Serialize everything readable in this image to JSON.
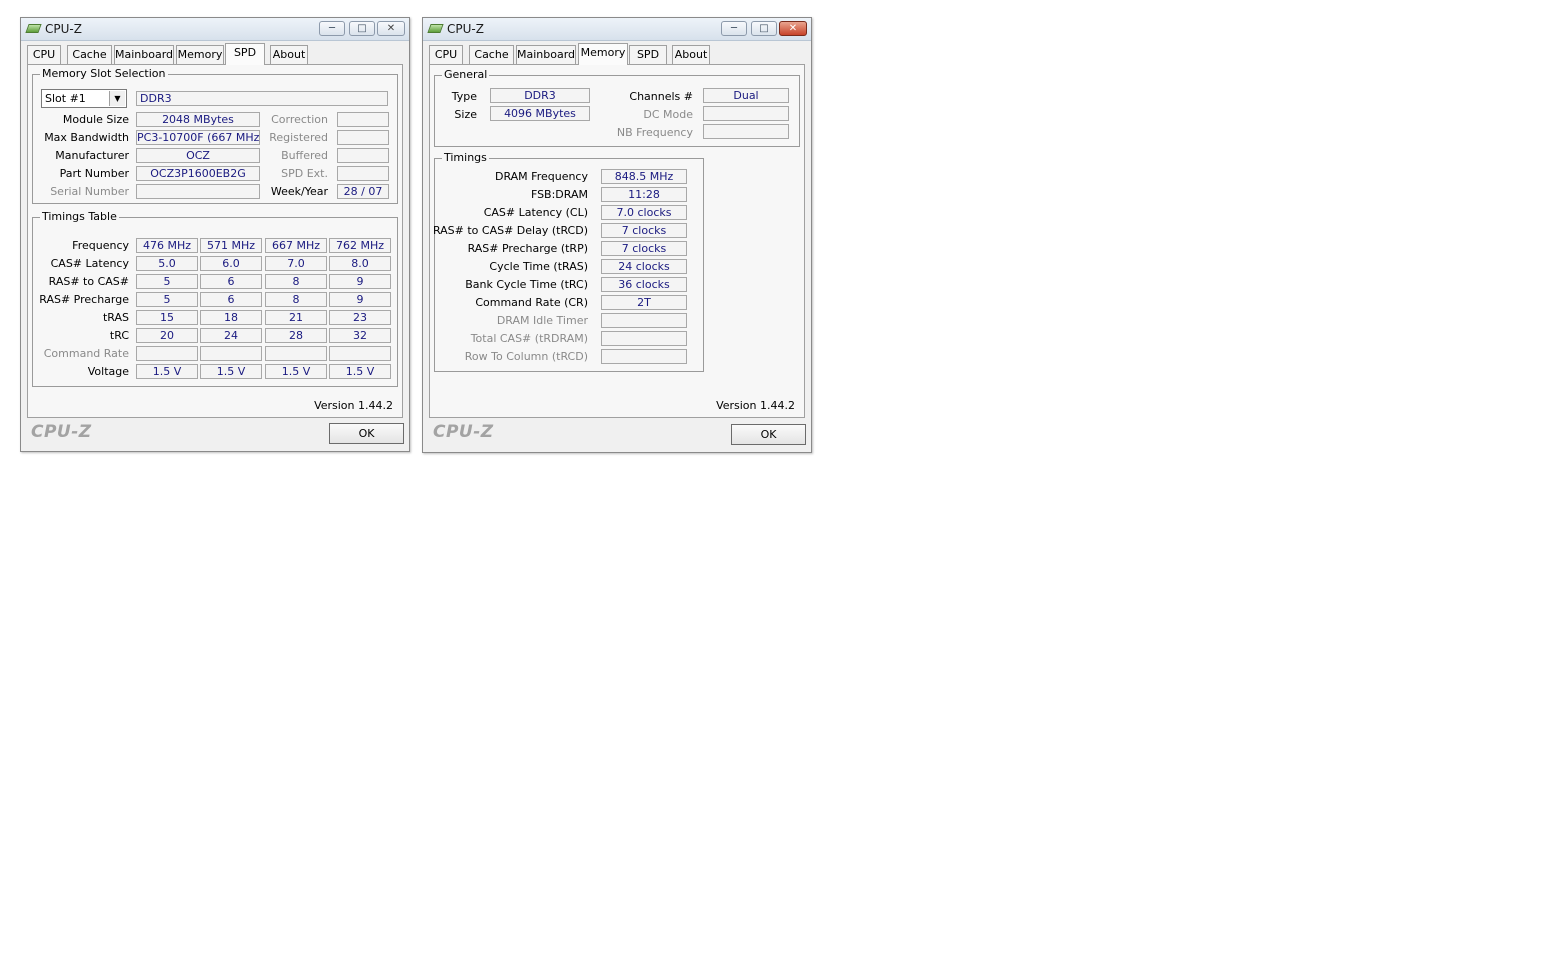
{
  "window1": {
    "title": "CPU-Z",
    "tabs": [
      "CPU",
      "Cache",
      "Mainboard",
      "Memory",
      "SPD",
      "About"
    ],
    "active_tab": "SPD",
    "slot_group_title": "Memory Slot Selection",
    "slot_select": "Slot #1",
    "slot_type": "DDR3",
    "left_fields": [
      {
        "label": "Module Size",
        "value": "2048 MBytes"
      },
      {
        "label": "Max Bandwidth",
        "value": "PC3-10700F (667 MHz)"
      },
      {
        "label": "Manufacturer",
        "value": "OCZ"
      },
      {
        "label": "Part Number",
        "value": "OCZ3P1600EB2G"
      },
      {
        "label": "Serial Number",
        "value": ""
      }
    ],
    "right_fields": [
      {
        "label": "Correction",
        "value": ""
      },
      {
        "label": "Registered",
        "value": ""
      },
      {
        "label": "Buffered",
        "value": ""
      },
      {
        "label": "SPD Ext.",
        "value": ""
      },
      {
        "label": "Week/Year",
        "value": "28 / 07"
      }
    ],
    "timings_group_title": "Timings Table",
    "timings_rows": [
      {
        "label": "Frequency",
        "values": [
          "476 MHz",
          "571 MHz",
          "667 MHz",
          "762 MHz"
        ]
      },
      {
        "label": "CAS# Latency",
        "values": [
          "5.0",
          "6.0",
          "7.0",
          "8.0"
        ]
      },
      {
        "label": "RAS# to CAS#",
        "values": [
          "5",
          "6",
          "8",
          "9"
        ]
      },
      {
        "label": "RAS# Precharge",
        "values": [
          "5",
          "6",
          "8",
          "9"
        ]
      },
      {
        "label": "tRAS",
        "values": [
          "15",
          "18",
          "21",
          "23"
        ]
      },
      {
        "label": "tRC",
        "values": [
          "20",
          "24",
          "28",
          "32"
        ]
      },
      {
        "label": "Command Rate",
        "values": [
          "",
          "",
          "",
          ""
        ]
      },
      {
        "label": "Voltage",
        "values": [
          "1.5 V",
          "1.5 V",
          "1.5 V",
          "1.5 V"
        ]
      }
    ],
    "version": "Version 1.44.2",
    "logo": "CPU-Z",
    "ok_label": "OK"
  },
  "window2": {
    "title": "CPU-Z",
    "tabs": [
      "CPU",
      "Cache",
      "Mainboard",
      "Memory",
      "SPD",
      "About"
    ],
    "active_tab": "Memory",
    "general_title": "General",
    "type_label": "Type",
    "type_value": "DDR3",
    "size_label": "Size",
    "size_value": "4096 MBytes",
    "channels_label": "Channels #",
    "channels_value": "Dual",
    "dcmode_label": "DC Mode",
    "dcmode_value": "",
    "nbfreq_label": "NB Frequency",
    "nbfreq_value": "",
    "timings_title": "Timings",
    "timings": [
      {
        "label": "DRAM Frequency",
        "value": "848.5 MHz"
      },
      {
        "label": "FSB:DRAM",
        "value": "11:28"
      },
      {
        "label": "CAS# Latency (CL)",
        "value": "7.0 clocks"
      },
      {
        "label": "RAS# to CAS# Delay (tRCD)",
        "value": "7 clocks"
      },
      {
        "label": "RAS# Precharge (tRP)",
        "value": "7 clocks"
      },
      {
        "label": "Cycle Time (tRAS)",
        "value": "24 clocks"
      },
      {
        "label": "Bank Cycle Time (tRC)",
        "value": "36 clocks"
      },
      {
        "label": "Command Rate (CR)",
        "value": "2T"
      },
      {
        "label": "DRAM Idle Timer",
        "value": ""
      },
      {
        "label": "Total CAS# (tRDRAM)",
        "value": ""
      },
      {
        "label": "Row To Column (tRCD)",
        "value": ""
      }
    ],
    "version": "Version 1.44.2",
    "logo": "CPU-Z",
    "ok_label": "OK"
  }
}
